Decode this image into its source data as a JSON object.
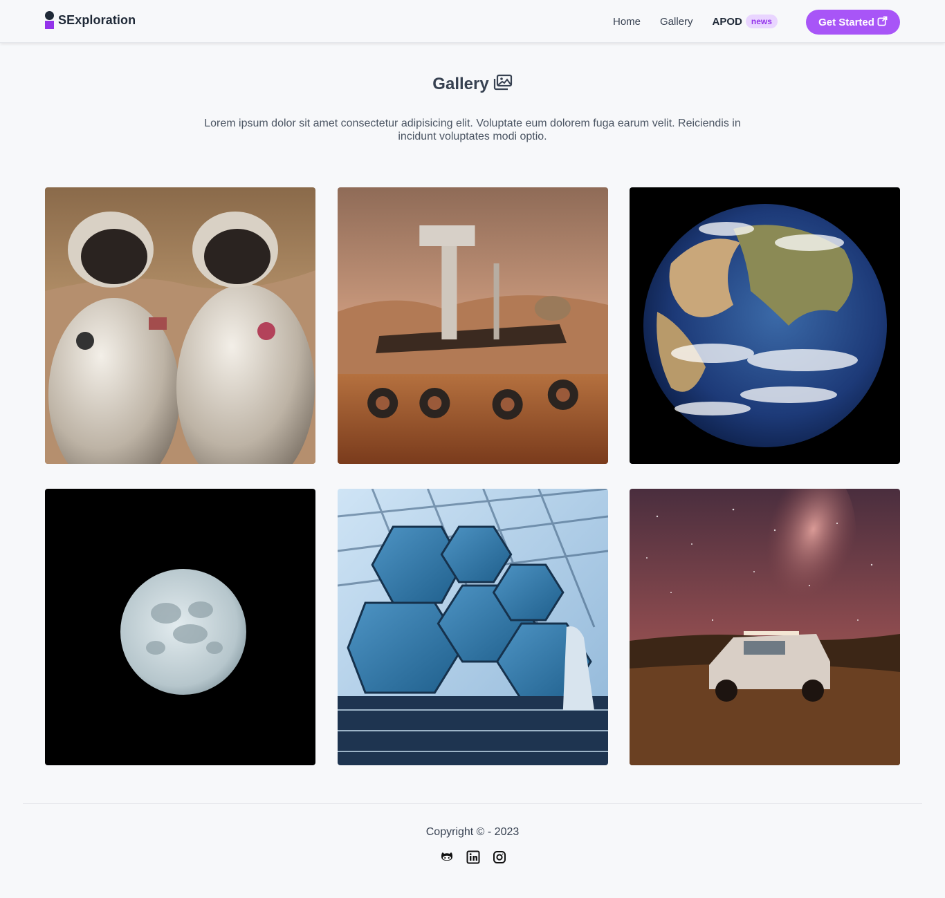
{
  "navbar": {
    "brand": "SExploration",
    "links": [
      {
        "label": "Home"
      },
      {
        "label": "Gallery"
      }
    ],
    "apod": {
      "label": "APOD",
      "badge": "news"
    },
    "cta": {
      "label": "Get Started"
    }
  },
  "gallery": {
    "title": "Gallery",
    "description": "Lorem ipsum dolor sit amet consectetur adipisicing elit. Voluptate eum dolorem fuga earum velit. Reiciendis in incidunt voluptates modi optio.",
    "images": [
      {
        "subject": "two astronauts in silver spacesuits"
      },
      {
        "subject": "mars rover"
      },
      {
        "subject": "planet earth"
      },
      {
        "subject": "full moon"
      },
      {
        "subject": "telescope hexagonal mirrors"
      },
      {
        "subject": "car under milky way"
      }
    ]
  },
  "footer": {
    "copyright": "Copyright © - 2023",
    "social": [
      "github-icon",
      "linkedin-icon",
      "instagram-icon"
    ]
  },
  "colors": {
    "accent": "#a855f7",
    "badge_bg": "#e9d5ff",
    "badge_text": "#9333ea",
    "background": "#f7f8fa"
  }
}
